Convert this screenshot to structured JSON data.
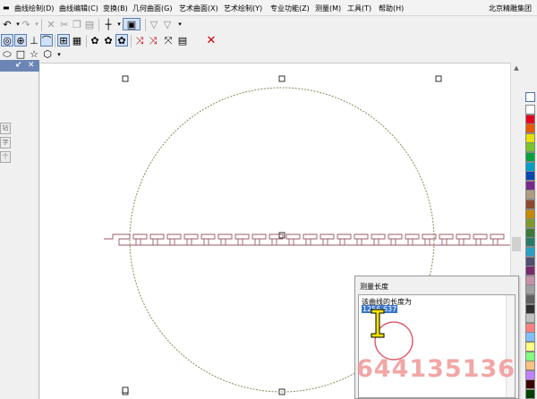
{
  "menu": {
    "items": [
      "曲线绘制(D)",
      "曲线编辑(C)",
      "变换(B)",
      "几何曲面(G)",
      "艺术曲面(X)",
      "艺术绘制(Y)",
      "专业功能(Z)",
      "测量(M)",
      "工具(T)",
      "帮助(H)"
    ],
    "company": "北京精雕集团"
  },
  "toolbar1": {
    "icons": [
      "undo-icon",
      "redo-icon",
      "delete-icon",
      "cut-icon",
      "copy-icon",
      "paste-icon",
      "crosshair-icon",
      "view-mode-icon",
      "bucket-icon",
      "bucket-alt-icon"
    ]
  },
  "toolbar2": {
    "icons": [
      "target-circle-icon",
      "circle-center-icon",
      "point-icon",
      "tangent-icon",
      "grid-snap-icon",
      "grid-alt-icon",
      "blob-icon",
      "blob-alt-icon",
      "blob-select-icon",
      "node-add-icon",
      "node-delete-icon",
      "node-connect-icon",
      "clipboard-icon",
      "close-x-icon"
    ]
  },
  "toolbar3": {
    "icons": [
      "ellipse-icon",
      "rectangle-icon",
      "star-icon",
      "hexagon-icon"
    ]
  },
  "left_panel": {
    "tabs": [
      "钻",
      "字",
      "个"
    ]
  },
  "colors": {
    "menubar_bg": "#f3f3f3",
    "canvas_bg": "#ffffff",
    "circle": "#8a8a5a",
    "curve": "#9a5a66",
    "selection_value_bg": "#3a77c9",
    "panel_header": "#6b86b4",
    "watermark": "#f09696"
  },
  "palette": [
    "#ffffff",
    "#e6001c",
    "#e85a00",
    "#e8e000",
    "#79c42b",
    "#00a33c",
    "#00a0c6",
    "#0047b0",
    "#7a2a8c",
    "#b09a80",
    "#8c4a2a",
    "#c48a00",
    "#7d9a2a",
    "#3c7a3c",
    "#2a7a6a",
    "#2aa0c0",
    "#505070",
    "#7a2a6a",
    "#c890a8",
    "#a0a0a0",
    "#606060",
    "#303030",
    "#c0c0c0",
    "#ff8080",
    "#80c0ff",
    "#ffff80",
    "#80ff80",
    "#ffc080",
    "#c080ff",
    "#400000",
    "#004000"
  ],
  "dialog": {
    "title": "测量长度",
    "label": "该曲线的长度为",
    "value": "1256.637"
  },
  "watermark": "644135136"
}
